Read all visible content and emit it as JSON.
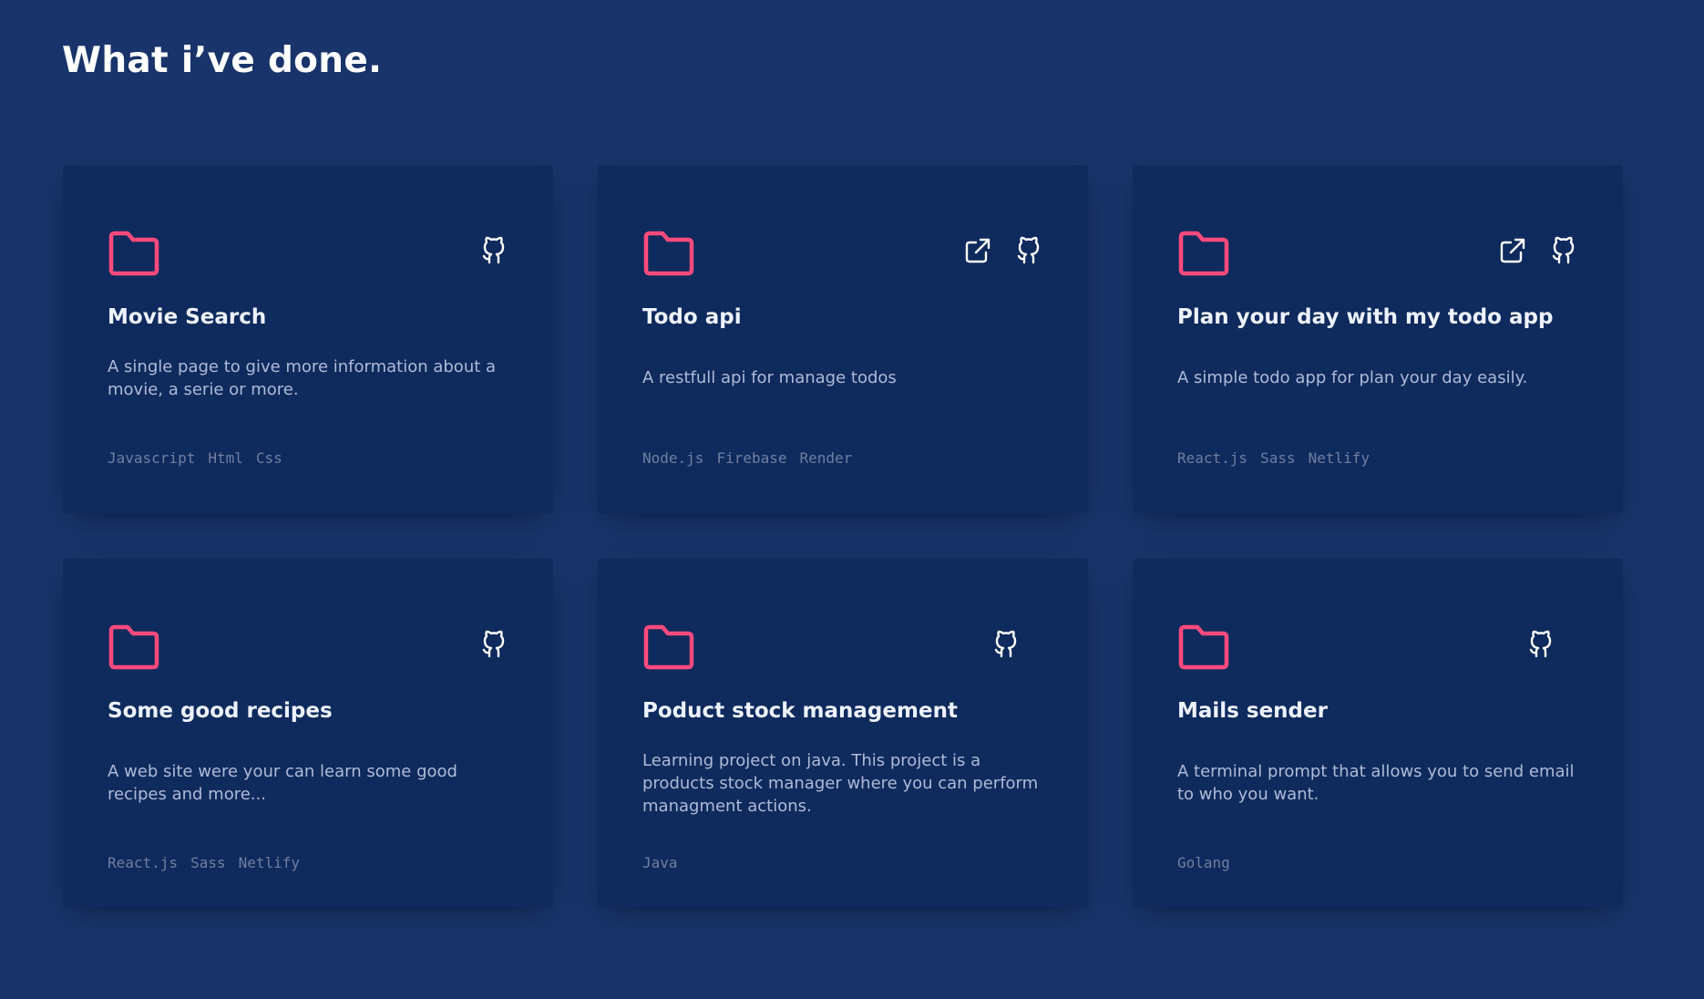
{
  "section": {
    "title": "What i’ve done."
  },
  "colors": {
    "background": "#18346a",
    "card": "#0f2a5c",
    "accent": "#ff4a7d",
    "description": "#aebbd8",
    "tags": "#6f7fa3"
  },
  "projects": [
    {
      "title": "Movie Search",
      "description": "A single page to give more information about a movie, a serie or more.",
      "tags": [
        "Javascript",
        "Html",
        "Css"
      ],
      "icons": [
        "github-icon"
      ]
    },
    {
      "title": "Todo api",
      "description": "A restfull api for manage todos",
      "tags": [
        "Node.js",
        "Firebase",
        "Render"
      ],
      "icons": [
        "external-link-icon",
        "github-icon"
      ]
    },
    {
      "title": "Plan your day with my todo app",
      "description": "A simple todo app for plan your day easily.",
      "tags": [
        "React.js",
        "Sass",
        "Netlify"
      ],
      "icons": [
        "external-link-icon",
        "github-icon"
      ]
    },
    {
      "title": "Some good recipes",
      "description": "A web site were your can learn some good recipes and more...",
      "tags": [
        "React.js",
        "Sass",
        "Netlify"
      ],
      "icons": [
        "github-icon"
      ]
    },
    {
      "title": "Poduct stock management",
      "description": "Learning project on java. This project is a products stock manager where you can perform managment actions.",
      "tags": [
        "Java"
      ],
      "icons": [
        "github-icon"
      ]
    },
    {
      "title": "Mails sender",
      "description": "A terminal prompt that allows you to send email to who you want.",
      "tags": [
        "Golang"
      ],
      "icons": [
        "github-icon"
      ]
    }
  ]
}
